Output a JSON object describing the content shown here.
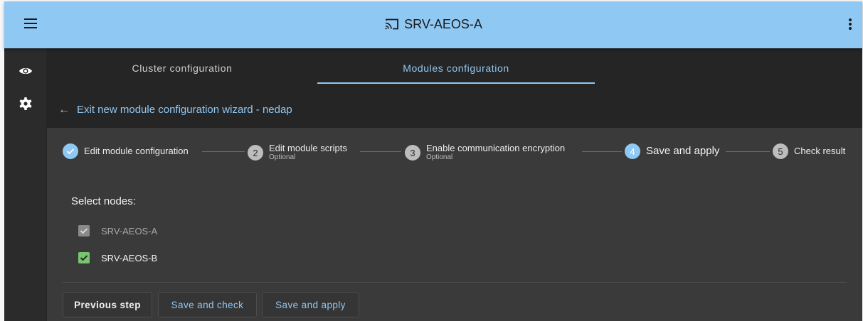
{
  "header": {
    "title": "SRV-AEOS-A",
    "menu_icon": "hamburger-menu-icon",
    "cast_icon": "cast-icon",
    "more_icon": "more-vertical-icon",
    "color": "#90c8f4"
  },
  "rail": {
    "items": [
      {
        "icon": "eye-icon"
      },
      {
        "icon": "gear-icon"
      }
    ]
  },
  "tabs": [
    {
      "label": "Cluster configuration",
      "active": false
    },
    {
      "label": "Modules configuration",
      "active": true
    }
  ],
  "exit_link": "Exit new module configuration wizard - nedap",
  "wizard": {
    "steps": [
      {
        "number": "1",
        "label": "Edit module configuration",
        "optional": "",
        "state": "completed"
      },
      {
        "number": "2",
        "label": "Edit module scripts",
        "optional": "Optional",
        "state": "pending"
      },
      {
        "number": "3",
        "label": "Enable communication encryption",
        "optional": "Optional",
        "state": "pending"
      },
      {
        "number": "4",
        "label": "Save and apply",
        "optional": "",
        "state": "active"
      },
      {
        "number": "5",
        "label": "Check result",
        "optional": "",
        "state": "pending"
      }
    ],
    "select_label": "Select nodes:",
    "nodes": [
      {
        "label": "SRV-AEOS-A",
        "checked": true,
        "disabled": true
      },
      {
        "label": "SRV-AEOS-B",
        "checked": true,
        "disabled": false
      }
    ],
    "buttons": {
      "previous": "Previous step",
      "save_check": "Save and check",
      "save_apply": "Save and apply"
    }
  },
  "colors": {
    "accent": "#90c8f4",
    "check_green": "#77c56e"
  }
}
